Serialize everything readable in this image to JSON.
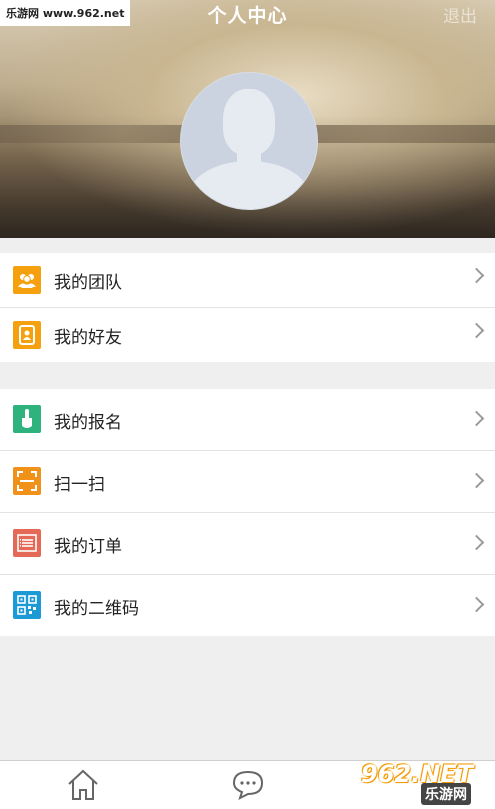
{
  "header": {
    "watermark_top": "乐游网 www.962.net",
    "title": "个人中心",
    "logout": "退出"
  },
  "menu_group_1": [
    {
      "label": "我的团队",
      "icon": "team-icon",
      "color": "#f5a10f"
    },
    {
      "label": "我的好友",
      "icon": "contacts-icon",
      "color": "#f5a10f"
    }
  ],
  "menu_group_2": [
    {
      "label": "我的报名",
      "icon": "signup-hand-icon",
      "color": "#2fb37e"
    },
    {
      "label": "扫一扫",
      "icon": "scan-icon",
      "color": "#f0921a"
    },
    {
      "label": "我的订单",
      "icon": "order-list-icon",
      "color": "#e46956"
    },
    {
      "label": "我的二维码",
      "icon": "qrcode-icon",
      "color": "#1c9ad6"
    }
  ],
  "tabbar": {
    "tabs": [
      {
        "icon": "home-icon"
      },
      {
        "icon": "chat-bubble-icon"
      }
    ]
  },
  "watermark_bottom": {
    "num": "962.NET",
    "sub": "乐游网"
  }
}
